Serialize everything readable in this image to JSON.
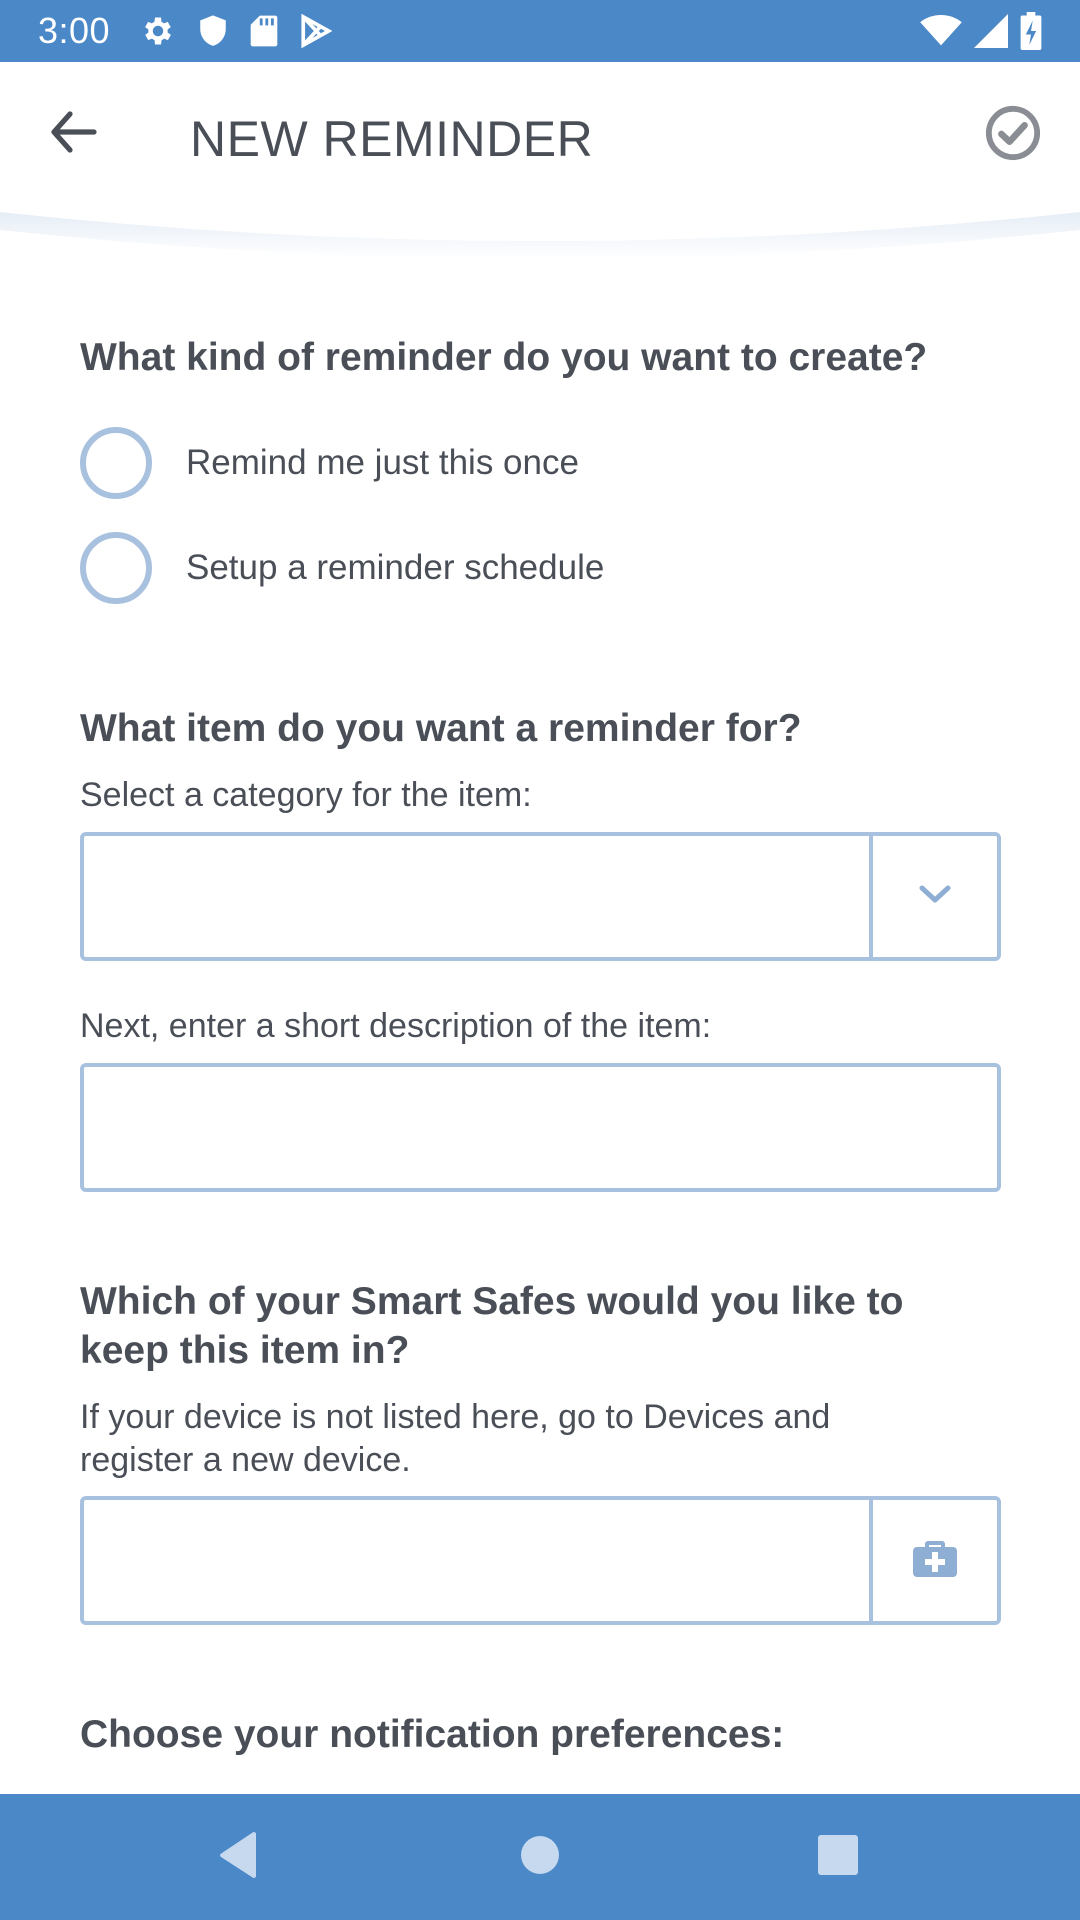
{
  "status_bar": {
    "time": "3:00",
    "icons_left": [
      "gear-icon",
      "shield-icon",
      "sd-card-icon",
      "play-store-icon"
    ],
    "icons_right": [
      "wifi-icon",
      "signal-icon",
      "battery-charging-icon"
    ]
  },
  "app_bar": {
    "title": "NEW REMINDER",
    "back_icon": "arrow-left-icon",
    "confirm_icon": "check-circle-icon"
  },
  "section_kind": {
    "title": "What kind of reminder do you want to create?",
    "options": [
      {
        "label": "Remind me just this once",
        "selected": false
      },
      {
        "label": "Setup a reminder schedule",
        "selected": false
      }
    ]
  },
  "section_item": {
    "title": "What item do you want a reminder for?",
    "category_hint": "Select a category for the item:",
    "category_value": "",
    "description_hint": "Next, enter a short description of the item:",
    "description_value": ""
  },
  "section_safe": {
    "title_line1": "Which of your Smart Safes would you like to",
    "title_line2": "keep this item in?",
    "hint_line1": "If your device is not listed here, go to Devices and",
    "hint_line2": "register a new device.",
    "safe_value": ""
  },
  "section_notify": {
    "title": "Choose your notification preferences:"
  },
  "colors": {
    "primary": "#4a88c7",
    "border": "#a8c1de",
    "text": "#4a4f57"
  }
}
